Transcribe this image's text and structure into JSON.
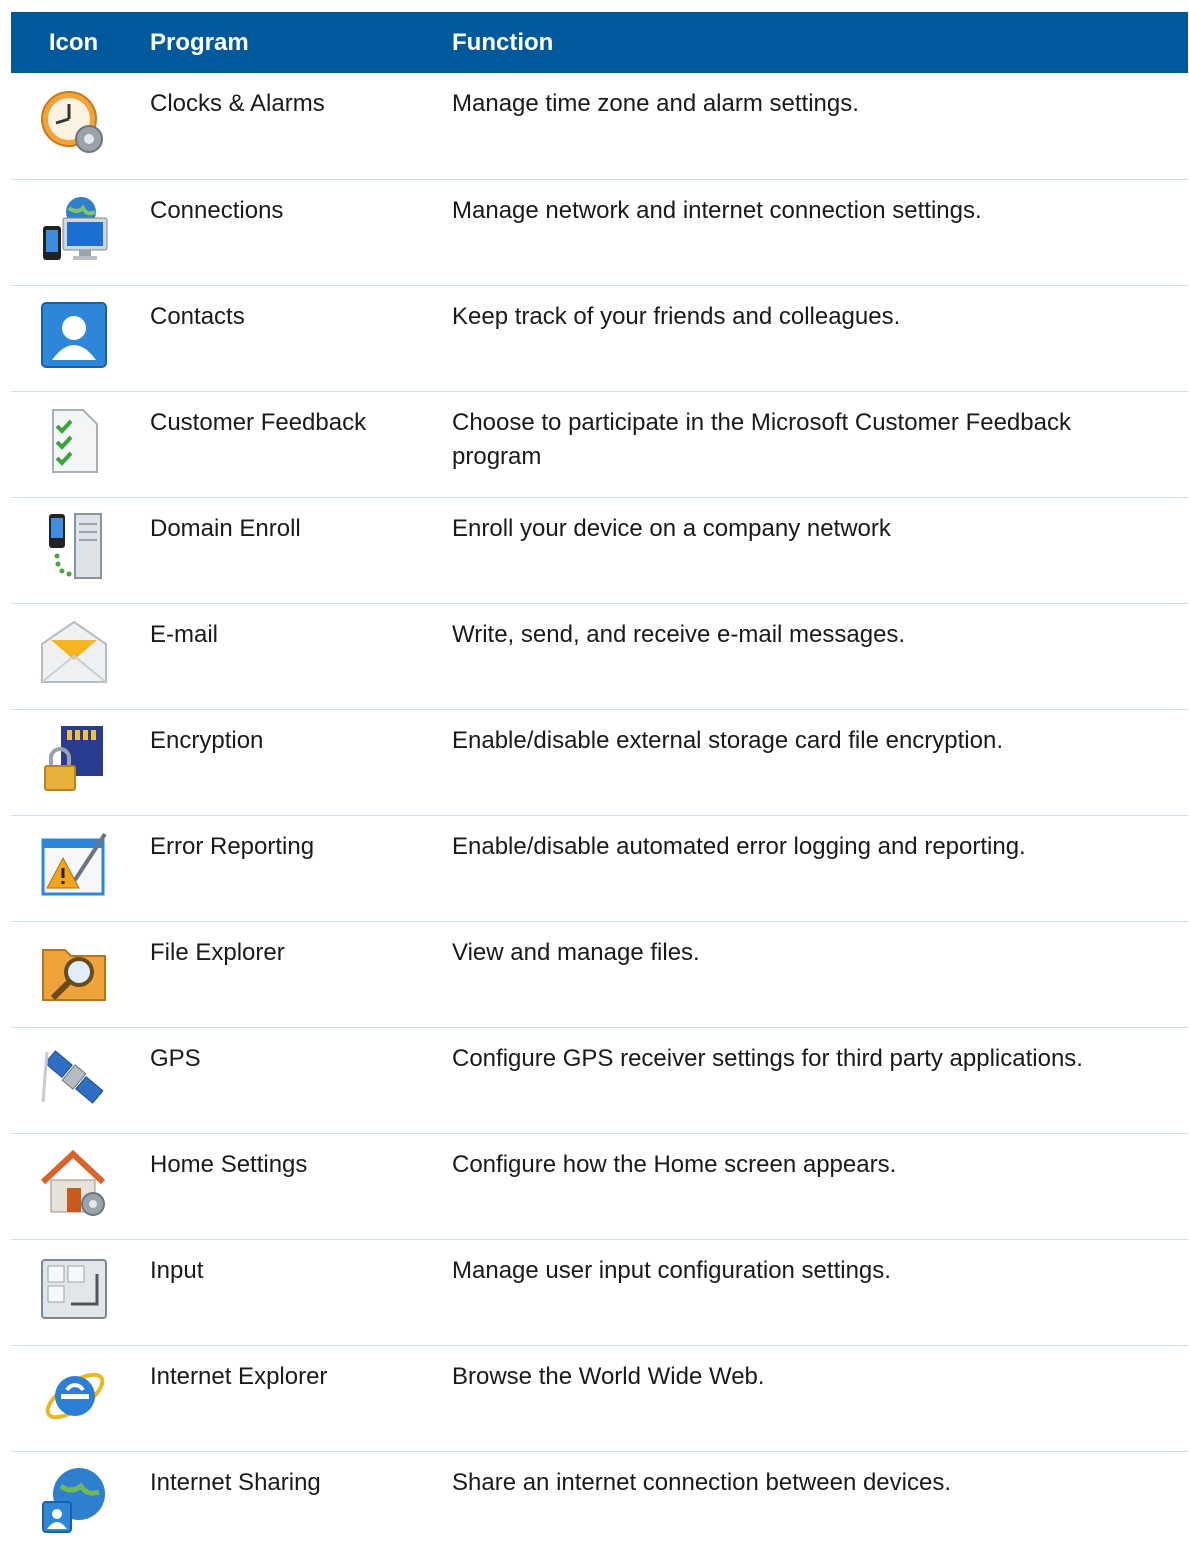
{
  "table": {
    "headers": {
      "icon": "Icon",
      "program": "Program",
      "function": "Function"
    },
    "rows": [
      {
        "icon": "clock-gear-icon",
        "program": "Clocks & Alarms",
        "function": "Manage time zone and alarm settings."
      },
      {
        "icon": "connections-icon",
        "program": "Connections",
        "function": "Manage network and internet connection settings."
      },
      {
        "icon": "contacts-icon",
        "program": "Contacts",
        "function": "Keep track of your friends and colleagues."
      },
      {
        "icon": "checklist-icon",
        "program": "Customer Feedback",
        "function": "Choose to participate in the Microsoft Customer Feedback program"
      },
      {
        "icon": "domain-enroll-icon",
        "program": "Domain Enroll",
        "function": "Enroll your device on a company network"
      },
      {
        "icon": "envelope-icon",
        "program": "E-mail",
        "function": "Write, send, and receive e-mail messages."
      },
      {
        "icon": "sd-card-lock-icon",
        "program": "Encryption",
        "function": "Enable/disable external storage card file encryption."
      },
      {
        "icon": "error-report-icon",
        "program": "Error Reporting",
        "function": "Enable/disable automated error logging and reporting."
      },
      {
        "icon": "folder-magnifier-icon",
        "program": "File Explorer",
        "function": "View and manage files."
      },
      {
        "icon": "satellite-icon",
        "program": "GPS",
        "function": "Configure GPS receiver settings for third party applications."
      },
      {
        "icon": "house-gear-icon",
        "program": "Home Settings",
        "function": "Configure how the Home screen appears."
      },
      {
        "icon": "keyboard-input-icon",
        "program": "Input",
        "function": "Manage user input configuration settings."
      },
      {
        "icon": "internet-explorer-icon",
        "program": "Internet Explorer",
        "function": "Browse the World Wide Web."
      },
      {
        "icon": "globe-user-icon",
        "program": "Internet Sharing",
        "function": "Share an internet connection between devices."
      }
    ]
  },
  "colors": {
    "header_bg": "#00599a",
    "header_text": "#ffffff",
    "row_divider": "#cfe0ee"
  }
}
